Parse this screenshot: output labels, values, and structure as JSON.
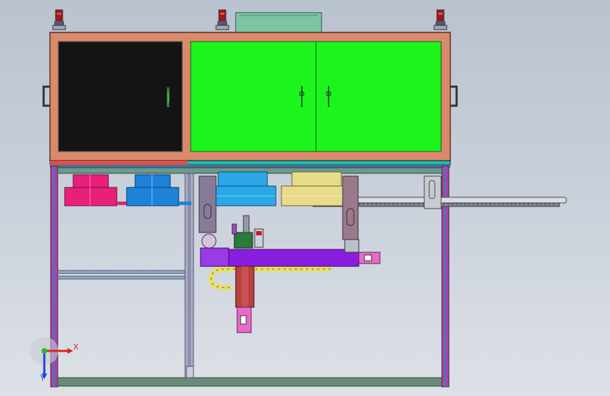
{
  "triad": {
    "x_label": "X",
    "y_label": "Y"
  },
  "colors": {
    "cabinet_frame": "#d98a6a",
    "left_door": "#141414",
    "right_doors": "#1cf51c",
    "hood": "#7cc4a4",
    "frame_blue": "#4a6fa5",
    "frame_magenta": "#c0308a",
    "bowl_pink": "#e8207a",
    "bowl_blue": "#1e82d8",
    "bowl_cyan": "#2aa8e8",
    "bowl_yellow": "#e8dc8a",
    "carriage_purple": "#8a1ee0",
    "cable_chain": "#e8e060",
    "motor_pink": "#e86ac8",
    "axis_x": "#e02020",
    "axis_y": "#2040e0",
    "axis_z": "#20c020"
  }
}
